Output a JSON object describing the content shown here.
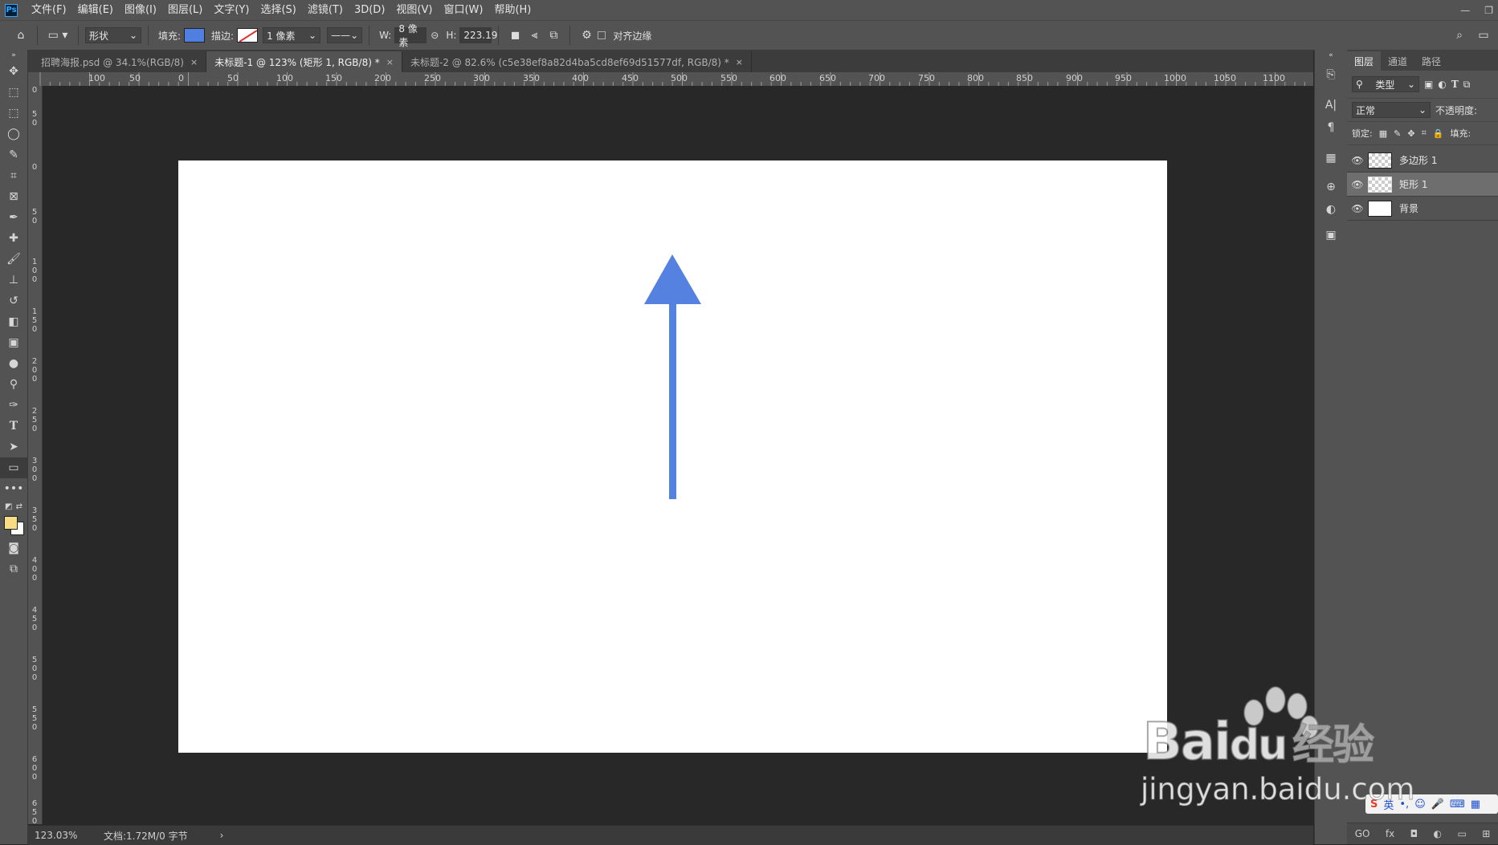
{
  "menu": {
    "logo": "Ps",
    "items": [
      "文件(F)",
      "编辑(E)",
      "图像(I)",
      "图层(L)",
      "文字(Y)",
      "选择(S)",
      "滤镜(T)",
      "3D(D)",
      "视图(V)",
      "窗口(W)",
      "帮助(H)"
    ]
  },
  "options": {
    "mode": "形状",
    "fill_label": "填充:",
    "stroke_label": "描边:",
    "stroke_width": "1 像素",
    "w_label": "W:",
    "w_value": "8 像素",
    "h_label": "H:",
    "h_value": "223.19",
    "align_edges": "对齐边缘",
    "fill_color": "#4f7fdf",
    "stroke_color": "#ffffff"
  },
  "tabs": [
    {
      "label": "招聘海报.psd @ 34.1%(RGB/8)",
      "close": "×"
    },
    {
      "label": "未标题-1 @ 123% (矩形 1, RGB/8) *",
      "close": "×"
    },
    {
      "label": "未标题-2 @ 82.6% (c5e38ef8a82d4ba5cd8ef69d51577df, RGB/8) *",
      "close": "×"
    }
  ],
  "ruler_top": [
    "100",
    "50",
    "0",
    "50",
    "100",
    "150",
    "200",
    "250",
    "300",
    "350",
    "400",
    "450",
    "500",
    "550",
    "600",
    "650",
    "700",
    "750",
    "800",
    "850",
    "900",
    "950",
    "1000",
    "1050",
    "1100"
  ],
  "ruler_left": [
    "0",
    "5\n0",
    "0",
    "5\n0",
    "1\n0\n0",
    "1\n5\n0",
    "2\n0\n0",
    "2\n5\n0",
    "3\n0\n0",
    "3\n5\n0",
    "4\n0\n0",
    "4\n5\n0",
    "5\n0\n0",
    "5\n5\n0",
    "6\n0\n0",
    "6\n5\n0"
  ],
  "status": {
    "zoom": "123.03%",
    "doc": "文档:1.72M/0 字节",
    "arrow": "›"
  },
  "panel": {
    "tabs": [
      "图层",
      "通道",
      "路径"
    ],
    "filter": "类型",
    "blend_mode": "正常",
    "opacity_label": "不透明度:",
    "lock_label": "锁定:",
    "fill_label": "填充:",
    "layers": [
      {
        "name": "多边形 1",
        "selected": false
      },
      {
        "name": "矩形 1",
        "selected": true
      },
      {
        "name": "背景",
        "selected": false
      }
    ],
    "footer": [
      "GO",
      "fx",
      "◘",
      "◐",
      "▭",
      "⊞"
    ]
  },
  "arrow_color": "#5581e0",
  "watermark": {
    "brand": "Bai",
    "brand2": "du",
    "cn": "经验",
    "url": "jingyan.baidu.com"
  },
  "ime": {
    "label": "英"
  }
}
